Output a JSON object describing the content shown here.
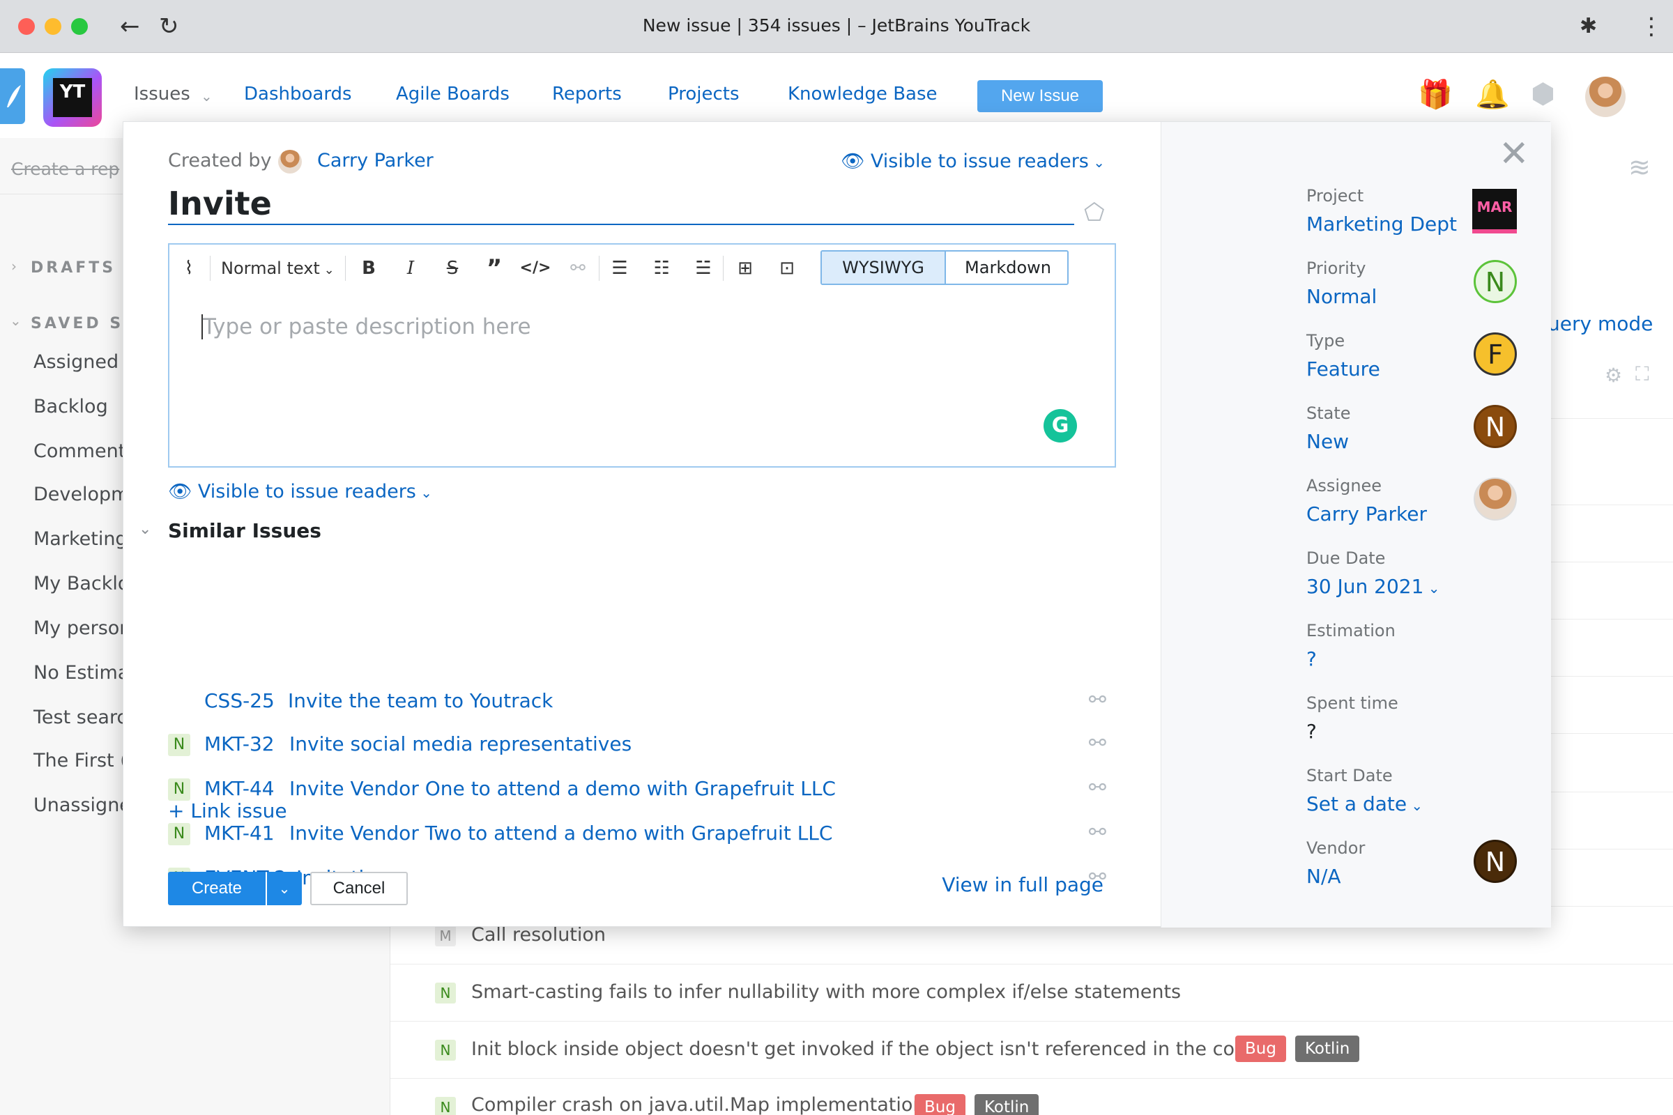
{
  "browser": {
    "title": "New issue | 354 issues | – JetBrains YouTrack",
    "back_icon": "←",
    "reload_icon": "↻",
    "extensions_icon": "✱",
    "menu_icon": "⋮"
  },
  "header": {
    "logo_text": "YT",
    "nav": {
      "issues": "Issues",
      "dashboards": "Dashboards",
      "agile_boards": "Agile Boards",
      "reports": "Reports",
      "projects": "Projects",
      "knowledge_base": "Knowledge Base"
    },
    "new_issue_button": "New Issue"
  },
  "sidebar": {
    "create_report": "Create a rep",
    "drafts": "DRAFTS",
    "saved_searches": "SAVED S",
    "items": [
      "Assigned",
      "Backlog",
      "Comment",
      "Developm",
      "Marketing",
      "My Backlo",
      "My persor",
      "No Estima",
      "Test searc",
      "The First (",
      "Unassigne"
    ]
  },
  "background": {
    "query_mode": "uery mode",
    "rows": [
      {
        "state": "M",
        "title": "Call resolution",
        "tags": []
      },
      {
        "state": "N",
        "title": "Smart-casting fails to infer nullability with more complex if/else statements",
        "tags": []
      },
      {
        "state": "N",
        "title": "Init block inside object doesn't get invoked if the object isn't referenced in the code",
        "tags": [
          "Bug",
          "Kotlin"
        ]
      },
      {
        "state": "N",
        "title": "Compiler crash on java.util.Map implementation",
        "tags": [
          "Bug",
          "Kotlin"
        ]
      }
    ]
  },
  "modal": {
    "created_by_label": "Created by",
    "creator_name": "Carry Parker",
    "visibility": "Visible to issue readers",
    "summary": "Invite",
    "editor": {
      "text_style": "Normal text",
      "mode_wysiwyg": "WYSIWYG",
      "mode_markdown": "Markdown",
      "placeholder": "Type or paste description here",
      "grammarly": "G"
    },
    "similar_title": "Similar Issues",
    "similar": [
      {
        "state": "",
        "id": "CSS-25",
        "title": "Invite the team to Youtrack"
      },
      {
        "state": "N",
        "id": "MKT-32",
        "title": "Invite social media representatives"
      },
      {
        "state": "N",
        "id": "MKT-44",
        "title": "Invite Vendor One to attend a demo with Grapefruit LLC"
      },
      {
        "state": "N",
        "id": "MKT-41",
        "title": "Invite Vendor Two to attend a demo with Grapefruit LLC"
      },
      {
        "state": "N",
        "id": "EVENT-2",
        "title": "Invitations"
      }
    ],
    "link_issue": "Link issue",
    "create_button": "Create",
    "cancel_button": "Cancel",
    "view_full_page": "View in full page"
  },
  "fields": {
    "project": {
      "label": "Project",
      "value": "Marketing Dept",
      "icon_text": "MAR"
    },
    "priority": {
      "label": "Priority",
      "value": "Normal",
      "letter": "N"
    },
    "type": {
      "label": "Type",
      "value": "Feature",
      "letter": "F"
    },
    "state": {
      "label": "State",
      "value": "New",
      "letter": "N"
    },
    "assignee": {
      "label": "Assignee",
      "value": "Carry Parker"
    },
    "due_date": {
      "label": "Due Date",
      "value": "30 Jun 2021"
    },
    "estimation": {
      "label": "Estimation",
      "value": "?"
    },
    "spent_time": {
      "label": "Spent time",
      "value": "?"
    },
    "start_date": {
      "label": "Start Date",
      "value": "Set a date"
    },
    "vendor": {
      "label": "Vendor",
      "value": "N/A",
      "letter": "N"
    }
  },
  "colors": {
    "accent": "#0b66c2",
    "new_issue_button": "#53a6ee",
    "create_button": "#1e88e5",
    "priority_normal": "#5cc33a",
    "type_feature": "#f6c02c",
    "state_new": "#8a4b0d",
    "tag_bug": "#e96a6a",
    "tag_kotlin": "#6f6f6f"
  }
}
